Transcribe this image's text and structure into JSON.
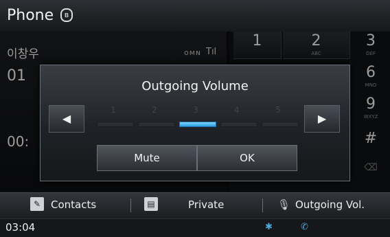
{
  "header": {
    "title": "Phone",
    "bt_icon": "bluetooth-icon",
    "bt_glyph": "ʙ"
  },
  "call": {
    "contact_name": "이창우",
    "signal_text": "ᴏᴍɴ",
    "signal_glyph": "Tıl",
    "number": "01",
    "timer": "00:"
  },
  "keypad": {
    "keys": [
      {
        "digit": "1",
        "letters": ""
      },
      {
        "digit": "2",
        "letters": "ABC"
      },
      {
        "digit": "3",
        "letters": "DEF"
      },
      {
        "digit": "6",
        "letters": "MNO"
      },
      {
        "digit": "9",
        "letters": "WXYZ"
      },
      {
        "digit": "#",
        "letters": ""
      }
    ],
    "delete_glyph": "⌫"
  },
  "dialog": {
    "title": "Outgoing Volume",
    "left_arrow": "◀",
    "right_arrow": "▶",
    "levels": [
      "1",
      "2",
      "3",
      "4",
      "5"
    ],
    "current_level": 3,
    "mute_label": "Mute",
    "ok_label": "OK"
  },
  "bottom_bar": {
    "contacts_label": "Contacts",
    "private_label": "Private",
    "outgoing_label": "Outgoing Vol."
  },
  "status_bar": {
    "clock": "03:04"
  },
  "colors": {
    "accent": "#2a9be0",
    "background": "#0b0c0e"
  }
}
